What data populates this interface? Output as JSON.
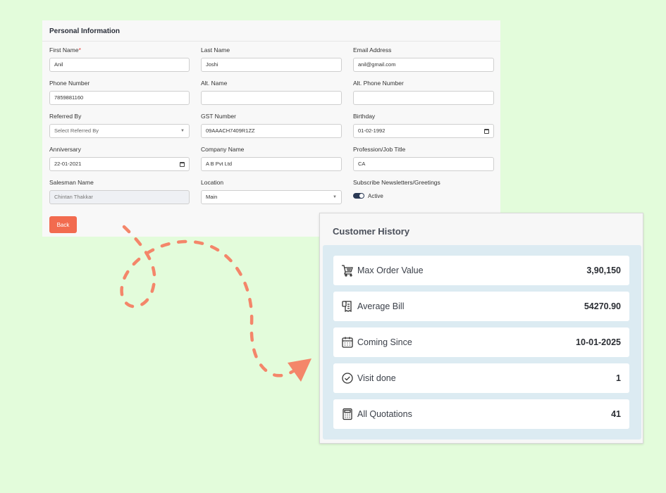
{
  "form": {
    "title": "Personal Information",
    "fields": [
      {
        "label": "First Name",
        "required": "*",
        "value": "Anil"
      },
      {
        "label": "Last Name",
        "value": "Joshi"
      },
      {
        "label": "Email Address",
        "value": "anil@gmail.com"
      },
      {
        "label": "Phone Number",
        "value": "7859881160"
      },
      {
        "label": "Alt. Name",
        "value": ""
      },
      {
        "label": "Alt. Phone Number",
        "value": ""
      },
      {
        "label": "Referred By",
        "value": "Select Referred By"
      },
      {
        "label": "GST Number",
        "value": "09AAACH7409R1ZZ"
      },
      {
        "label": "Birthday",
        "value": "01-02-1992"
      },
      {
        "label": "Anniversary",
        "value": "22-01-2021"
      },
      {
        "label": "Company Name",
        "value": "A B Pvt Ltd"
      },
      {
        "label": "Profession/Job Title",
        "value": "CA"
      },
      {
        "label": "Salesman Name",
        "value": "Chintan Thakkar"
      },
      {
        "label": "Location",
        "value": "Main"
      },
      {
        "label": "Subscribe Newsletters/Greetings",
        "value": "Active"
      }
    ],
    "back_label": "Back"
  },
  "history": {
    "title": "Customer History",
    "rows": [
      {
        "icon": "cart-icon",
        "label": "Max Order Value",
        "value": "3,90,150"
      },
      {
        "icon": "receipt-icon",
        "label": "Average Bill",
        "value": "54270.90"
      },
      {
        "icon": "calendar-icon",
        "label": "Coming Since",
        "value": "10-01-2025"
      },
      {
        "icon": "check-circle-icon",
        "label": "Visit done",
        "value": "1"
      },
      {
        "icon": "calculator-icon",
        "label": "All Quotations",
        "value": "41"
      }
    ]
  },
  "colors": {
    "background": "#e3fcdb",
    "accent": "#f26b4f",
    "history_panel": "#dcebf2"
  }
}
